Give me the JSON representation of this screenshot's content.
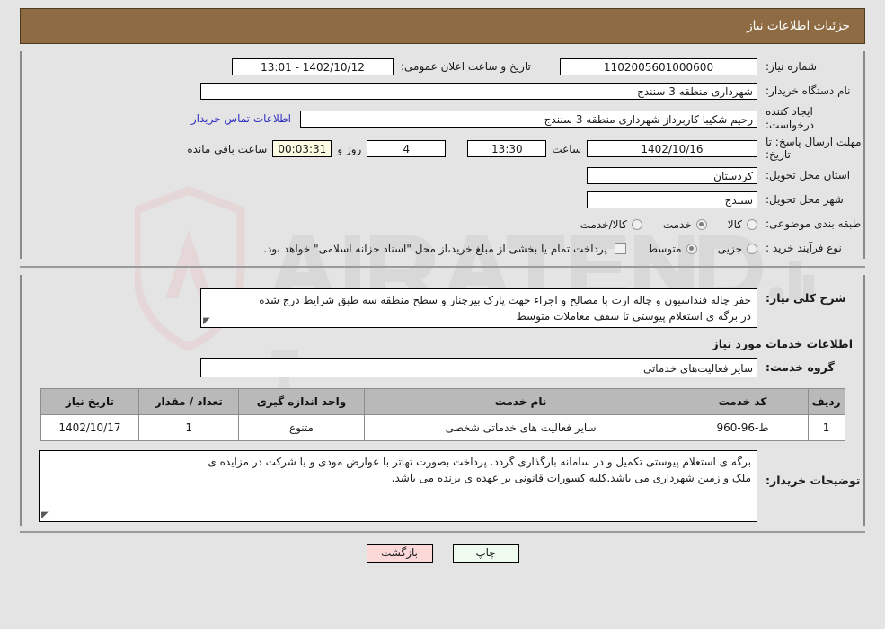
{
  "header": {
    "title": "جزئیات اطلاعات نیاز"
  },
  "form": {
    "need_number_label": "شماره نیاز:",
    "need_number_value": "1102005601000600",
    "announce_datetime_label": "تاریخ و ساعت اعلان عمومی:",
    "announce_datetime_value": "1402/10/12 - 13:01",
    "buyer_org_label": "نام دستگاه خریدار:",
    "buyer_org_value": "شهرداری منطقه 3 سنندج",
    "creator_label": "ایجاد کننده درخواست:",
    "creator_value": "رحیم شکیبا کاربرداز شهرداری منطقه 3 سنندج",
    "contact_link": "اطلاعات تماس خریدار",
    "deadline_label": "مهلت ارسال پاسخ: تا تاریخ:",
    "deadline_date": "1402/10/16",
    "hour_label": "ساعت",
    "deadline_time": "13:30",
    "days_remaining": "4",
    "days_label": "روز و",
    "countdown": "00:03:31",
    "countdown_label": "ساعت باقی مانده",
    "province_label": "استان محل تحویل:",
    "province_value": "کردستان",
    "city_label": "شهر محل تحویل:",
    "city_value": "سنندج",
    "category_label": "طبقه بندی موضوعی:",
    "category_options": [
      {
        "label": "کالا",
        "selected": false
      },
      {
        "label": "خدمت",
        "selected": true
      },
      {
        "label": "کالا/خدمت",
        "selected": false
      }
    ],
    "process_label": "نوع فرآیند خرید :",
    "process_options": [
      {
        "label": "جزیی",
        "selected": false
      },
      {
        "label": "متوسط",
        "selected": true
      }
    ],
    "treasury_checkbox_text": "پرداخت تمام یا بخشی از مبلغ خرید،از محل \"اسناد خزانه اسلامی\" خواهد بود.",
    "treasury_checked": false
  },
  "description": {
    "label": "شرح کلی نیاز:",
    "line1": "حفر چاله فنداسیون و چاله ارت با مصالح و اجراء جهت پارک بیرچنار و سطح منطقه سه طبق شرایط درج شده",
    "line2": "در برگه ی استعلام پیوستی تا سقف معاملات متوسط"
  },
  "services": {
    "section_heading": "اطلاعات خدمات مورد نیاز",
    "group_label": "گروه خدمت:",
    "group_value": "سایر فعالیت‌های خدماتی",
    "table": {
      "columns": [
        "ردیف",
        "کد خدمت",
        "نام خدمت",
        "واحد اندازه گیری",
        "تعداد / مقدار",
        "تاریخ نیاز"
      ],
      "rows": [
        {
          "index": "1",
          "code": "ط-96-960",
          "name": "سایر فعالیت های خدماتی شخصی",
          "unit": "متنوع",
          "quantity": "1",
          "need_date": "1402/10/17"
        }
      ]
    }
  },
  "buyer_notes": {
    "label": "توضیحات خریدار:",
    "line1": "برگه ی استعلام پیوستی تکمیل و در سامانه بارگذاری گردد. پرداخت بصورت تهاتر با عوارض مودی و یا شرکت در مزایده ی",
    "line2": "ملک و زمین شهرداری می باشد.کلیه کسورات قانونی بر عهده ی برنده می باشد."
  },
  "footer": {
    "print_label": "چاپ",
    "back_label": "بازگشت"
  },
  "watermark": {
    "text": "AriaTender.net"
  },
  "colors": {
    "header_bg": "#8e6b43",
    "page_bg": "#e4e4e4",
    "link": "#3030c0",
    "table_header_bg": "#b9b9b9",
    "print_btn_bg": "#eefbee",
    "back_btn_bg": "#fbd9d9",
    "countdown_bg": "#fbfbe2"
  }
}
